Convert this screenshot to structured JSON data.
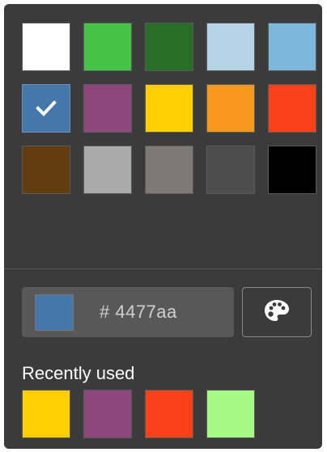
{
  "swatches": [
    {
      "color": "#ffffff",
      "selected": false
    },
    {
      "color": "#46c346",
      "selected": false
    },
    {
      "color": "#276e27",
      "selected": false
    },
    {
      "color": "#b4d4e6",
      "selected": false
    },
    {
      "color": "#7db8da",
      "selected": false
    },
    {
      "color": "#4477aa",
      "selected": true
    },
    {
      "color": "#8e477d",
      "selected": false
    },
    {
      "color": "#ffcf02",
      "selected": false
    },
    {
      "color": "#f8981d",
      "selected": false
    },
    {
      "color": "#fa4119",
      "selected": false
    },
    {
      "color": "#633c0f",
      "selected": false
    },
    {
      "color": "#aaaaaa",
      "selected": false
    },
    {
      "color": "#7b7a78",
      "selected": false
    },
    {
      "color": "#4d4d4d",
      "selected": false
    },
    {
      "color": "#000000",
      "selected": false
    }
  ],
  "current": {
    "color": "#4477aa",
    "hex_text": "# 4477aa"
  },
  "palette_button": {
    "icon": "palette-icon"
  },
  "recent": {
    "label": "Recently used",
    "colors": [
      "#ffcf02",
      "#8e477d",
      "#fa4119",
      "#a5fa85"
    ]
  }
}
